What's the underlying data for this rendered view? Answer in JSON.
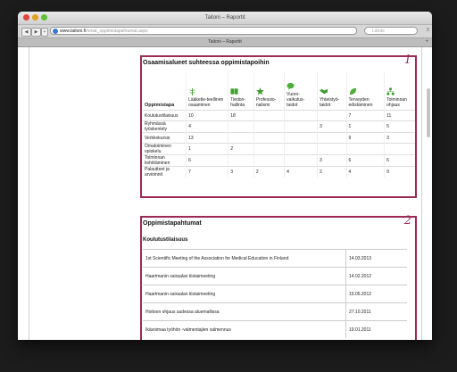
{
  "window": {
    "title": "Taitoni – Raportit",
    "tab_label": "Taitoni – Raportit",
    "url_host": "www.taitoni.fi",
    "url_path": "/omat_oppimistapahtumat.aspx",
    "search_placeholder": "Lähde"
  },
  "panel1": {
    "number": "1",
    "title": "Osaamisalueet suhteessa oppimistapoihin",
    "first_header": "Oppimistapa",
    "columns": [
      {
        "label": "Lääketie-teellinen osaaminen",
        "icon": "caduceus-icon",
        "color": "#4caf3a"
      },
      {
        "label": "Tiedon-hallinta",
        "icon": "book-icon",
        "color": "#3f9e2e"
      },
      {
        "label": "Professio-nalismi",
        "icon": "star-burst-icon",
        "color": "#3a9a2a"
      },
      {
        "label": "Vuoro-vaikutus-taidot",
        "icon": "speech-bubble-icon",
        "color": "#4caf3a"
      },
      {
        "label": "Yhteistyö-taidot",
        "icon": "handshake-icon",
        "color": "#3a9a2a"
      },
      {
        "label": "Terveyden edistäminen",
        "icon": "leaf-icon",
        "color": "#4caf3a"
      },
      {
        "label": "Toiminnan ohjaus",
        "icon": "org-chart-icon",
        "color": "#3a9a2a"
      }
    ],
    "rows": [
      {
        "name": "Koulutustilaisuus",
        "values": [
          "10",
          "18",
          "",
          "",
          "",
          "7",
          "11"
        ]
      },
      {
        "name": "Ryhmässä työskentely",
        "values": [
          "4",
          "",
          "",
          "",
          "3",
          "1",
          "5"
        ]
      },
      {
        "name": "Verkkokurssi",
        "values": [
          "13",
          "",
          "",
          "",
          "",
          "9",
          "3"
        ]
      },
      {
        "name": "Omatoiminen opiskelu",
        "values": [
          "1",
          "2",
          "",
          "",
          "",
          "",
          ""
        ]
      },
      {
        "name": "Toiminnan kehittäminen",
        "values": [
          "6",
          "",
          "",
          "",
          "3",
          "6",
          "6"
        ]
      },
      {
        "name": "Palautteet ja arvioinnit",
        "values": [
          "7",
          "3",
          "2",
          "4",
          "2",
          "4",
          "9"
        ]
      }
    ]
  },
  "panel2": {
    "number": "2",
    "title": "Oppimistapahtumat",
    "subtitle": "Koulutustilaisuus",
    "events": [
      {
        "name": "1st Scientific Meeting of the Association for Medical Education in Finland",
        "date": "14.03.2013"
      },
      {
        "name": "Haartmanin sairaalan tiistaimeeting",
        "date": "14.02.2012"
      },
      {
        "name": "Haartmanin sairaalan tiistaimeeting",
        "date": "15.05.2012"
      },
      {
        "name": "Hoitoon ohjaus uudessa aluemallissa",
        "date": "27.10.2011"
      },
      {
        "name": "Ikävoimaa työhön -valmentajien valmennus",
        "date": "19.01.2011"
      }
    ]
  }
}
